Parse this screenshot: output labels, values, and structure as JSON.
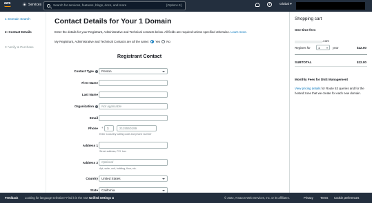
{
  "topnav": {
    "logo_text": "aws",
    "services_label": "Services",
    "search_placeholder": "Search for services, features, blogs, docs, and more",
    "search_shortcut": "[Option+S]",
    "help_glyph": "?",
    "region_label": "Global ▾",
    "icons": [
      "aws-logo",
      "grid-icon",
      "search-icon",
      "bell-icon",
      "help-icon"
    ]
  },
  "steps": [
    {
      "label": "1: Domain Search"
    },
    {
      "label": "2: Contact Details"
    },
    {
      "label": "3: Verify & Purchase"
    }
  ],
  "main": {
    "title": "Contact Details for Your 1 Domain",
    "intro": "Enter the details for your Registrant, Administrative and Technical contacts below. All fields are required unless specified otherwise.",
    "learn_more": "Learn more.",
    "same_question": "My Registrant, Administrative and Technical Contacts are all the same:",
    "yes_label": "Yes",
    "no_label": "No",
    "section_title": "Registrant Contact"
  },
  "form": {
    "contact_type": {
      "label": "Contact Type",
      "value": "Person"
    },
    "first_name": {
      "label": "First Name",
      "value": ""
    },
    "last_name": {
      "label": "Last Name",
      "value": ""
    },
    "organization": {
      "label": "Organization",
      "placeholder": "Not applicable"
    },
    "email": {
      "label": "Email",
      "value": ""
    },
    "phone": {
      "label": "Phone",
      "plus": "+",
      "country_code": "1",
      "number_placeholder": "2115550199",
      "help": "Enter a country calling code and phone number"
    },
    "address1": {
      "label": "Address 1",
      "value": "",
      "help": "Street address, P.O. box"
    },
    "address2": {
      "label": "Address 2",
      "placeholder": "Optional",
      "help": "Apt, suite, unit, building, floor, etc."
    },
    "country": {
      "label": "Country",
      "value": "United States"
    },
    "state": {
      "label": "State",
      "value": "California"
    }
  },
  "cart": {
    "heading": "Shopping cart",
    "one_time_fees": "One-time fees",
    "domain_suffix": ".com",
    "register_for": "Register for",
    "years_value": "1",
    "year_label": "year",
    "price": "$12.00",
    "subtotal_label": "SUBTOTAL",
    "subtotal_value": "$12.00",
    "monthly_fees": "Monthly Fees for DNS Management",
    "pricing_link": "View pricing details",
    "pricing_rest": " for Route 53 queries and for the hosted zone that we create for each new domain."
  },
  "footer": {
    "feedback": "Feedback",
    "lang_text": "Looking for language selection? Find it in the new",
    "unified_settings": "Unified Settings",
    "copyright": "© 2022, Amazon Web Services, Inc. or its affiliates.",
    "privacy": "Privacy",
    "terms": "Terms",
    "cookies": "Cookie preferences"
  },
  "colors": {
    "nav_bg": "#232f3e",
    "link": "#0073bb",
    "accent": "#ff9900"
  }
}
